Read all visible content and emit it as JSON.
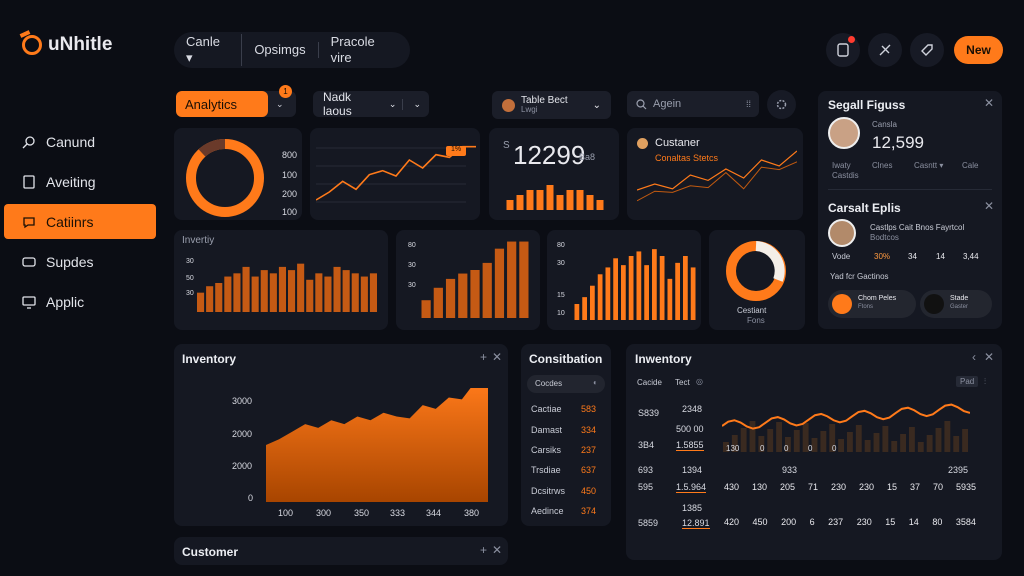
{
  "app": {
    "title": "uNhitle"
  },
  "topnav": [
    "Canle ▾",
    "Opsimgs",
    "Pracole vire"
  ],
  "header": {
    "new_label": "New",
    "notification_count": "1"
  },
  "sidebar": [
    {
      "label": "Canund",
      "icon": "search-icon",
      "active": false
    },
    {
      "label": "Aveiting",
      "icon": "document-icon",
      "active": false
    },
    {
      "label": "Catiinrs",
      "icon": "chat-icon",
      "active": true
    },
    {
      "label": "Supdes",
      "icon": "inbox-icon",
      "active": false
    },
    {
      "label": "Applic",
      "icon": "monitor-icon",
      "active": false
    }
  ],
  "toolbar": {
    "analytics_tab": "Analytics",
    "analytics_badge": "1",
    "select_label": "Nadk laous",
    "table_title": "Table Bect",
    "table_sub": "Lwgi",
    "search_placeholder": "Agein"
  },
  "kpi": {
    "value": "12299",
    "prefix": "S",
    "suffix": "Ba8"
  },
  "donut_axis": [
    "800",
    "100",
    "200",
    "100"
  ],
  "gauge_label": "1%",
  "customer_card": {
    "title": "Custaner",
    "subtitle": "Conaltas Stetcs"
  },
  "inventry_small": {
    "label": "Invertiy",
    "y_ticks": [
      "30",
      "50",
      "30"
    ]
  },
  "bars_mid": {
    "y_ticks": [
      "80",
      "30",
      "30"
    ]
  },
  "bars_right": {
    "y_ticks": [
      "80",
      "30",
      "15",
      "10"
    ]
  },
  "donut2": {
    "label": "Cestiant",
    "sub": "Fons"
  },
  "social": {
    "title": "Segall Figuss",
    "caption": "Cansla",
    "value": "12,599",
    "cols": [
      "Iwaty",
      "Clnes",
      "Casntt ▾",
      "Cale"
    ],
    "sub": "Castdis"
  },
  "contact": {
    "title": "Carsalt Eplis",
    "line1": "Castlps Cait Bnos Fayrtcol",
    "line2": "Bodtcos",
    "stats": [
      "Vode",
      "30%",
      "34",
      "14",
      "3,44"
    ],
    "footer": "Yad fcr Gactinos",
    "people": [
      {
        "name": "Chom Peles",
        "sub": "Ftons"
      },
      {
        "name": "Stade",
        "sub": "Gaster"
      }
    ]
  },
  "inventory": {
    "title": "Inventory",
    "y_ticks": [
      "3000",
      "2000",
      "2000",
      "0"
    ],
    "x_ticks": [
      "100",
      "300",
      "350",
      "333",
      "344",
      "380"
    ]
  },
  "constitution": {
    "title": "Consitbation",
    "search_label": "Cocdes",
    "rows": [
      {
        "label": "Cactiae",
        "value": "583"
      },
      {
        "label": "Damast",
        "value": "334"
      },
      {
        "label": "Carsiks",
        "value": "237"
      },
      {
        "label": "Trsdiae",
        "value": "637"
      },
      {
        "label": "Dcsitrws",
        "value": "450"
      },
      {
        "label": "Aedince",
        "value": "374"
      }
    ]
  },
  "inventory2": {
    "title": "Inwentory",
    "filter_label": "Cacide",
    "filter_value": "Tect",
    "badge": "Pad",
    "left_numbers": [
      "S839",
      "3B4",
      "693",
      "595",
      "5859"
    ],
    "left_values": [
      "2348",
      "500 00",
      "1.5855",
      "1394",
      "933",
      "1.5.964",
      "1385",
      "12.891"
    ],
    "axis_ticks": [
      "130",
      "0",
      "0",
      "0",
      "0"
    ],
    "row_a": [
      "430",
      "130",
      "205",
      "71",
      "230",
      "230",
      "15",
      "37",
      "70",
      "5935"
    ],
    "row_b": [
      "420",
      "450",
      "200",
      "6",
      "237",
      "230",
      "15",
      "14",
      "80",
      "3584"
    ],
    "right_top": "2395"
  },
  "customer_footer": {
    "title": "Customer"
  },
  "colors": {
    "accent": "#ff7a1a",
    "panel": "#151822",
    "background": "#0b0d14"
  },
  "chart_data": [
    {
      "type": "area",
      "title": "Inventory",
      "x": [
        "100",
        "300",
        "350",
        "333",
        "344",
        "380"
      ],
      "series": [
        {
          "values": [
            1500,
            1650,
            1850,
            2050,
            1950,
            2150,
            2050,
            2250,
            2150,
            2350,
            2250,
            2200,
            2550,
            2450,
            2750,
            2700,
            3150,
            3050
          ]
        }
      ],
      "ylim": [
        0,
        3000
      ]
    },
    {
      "type": "line",
      "series": [
        {
          "values": [
            160,
            190,
            230,
            200,
            255,
            270,
            250,
            310,
            280,
            330,
            320,
            360,
            360
          ]
        }
      ],
      "ylim": [
        100,
        800
      ]
    },
    {
      "type": "bar",
      "series": [
        {
          "values": [
            6,
            8,
            9,
            11,
            12,
            14,
            11,
            13,
            12,
            14,
            13,
            15,
            10,
            12,
            11,
            14,
            13,
            12,
            11,
            12
          ]
        }
      ],
      "ylim": [
        0,
        30
      ]
    },
    {
      "type": "bar",
      "series": [
        {
          "values": [
            20,
            34,
            44,
            50,
            54,
            62,
            78,
            86,
            86
          ]
        }
      ],
      "ylim": [
        0,
        80
      ]
    },
    {
      "type": "bar",
      "series": [
        {
          "values": [
            14,
            20,
            30,
            40,
            46,
            54,
            48,
            56,
            60,
            48,
            62,
            56,
            36,
            50,
            56,
            46
          ]
        }
      ],
      "ylim": [
        0,
        80
      ]
    },
    {
      "type": "bar",
      "series": [
        {
          "values": [
            2,
            3,
            4,
            4,
            5
          ]
        }
      ]
    },
    {
      "type": "line",
      "series": [
        {
          "values": [
            20,
            30,
            22,
            45,
            36,
            55,
            40,
            70,
            60,
            85
          ]
        }
      ]
    }
  ]
}
